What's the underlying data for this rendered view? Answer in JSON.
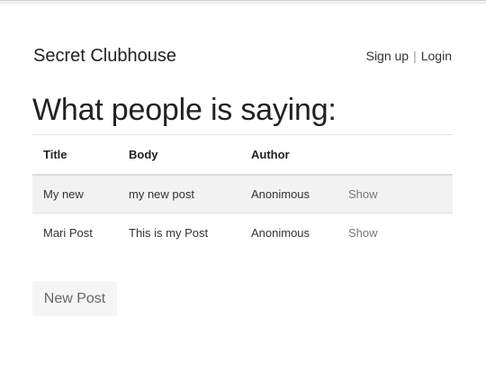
{
  "header": {
    "brand": "Secret Clubhouse",
    "nav": {
      "signup_label": "Sign up",
      "separator": "|",
      "login_label": "Login"
    }
  },
  "main": {
    "heading": "What people is saying:",
    "table": {
      "columns": [
        "Title",
        "Body",
        "Author",
        ""
      ],
      "rows": [
        {
          "title": "My new",
          "body": "my new post",
          "author": "Anonimous",
          "action": "Show"
        },
        {
          "title": "Mari Post",
          "body": "This is my Post",
          "author": "Anonimous",
          "action": "Show"
        }
      ]
    },
    "new_post_label": "New Post"
  }
}
